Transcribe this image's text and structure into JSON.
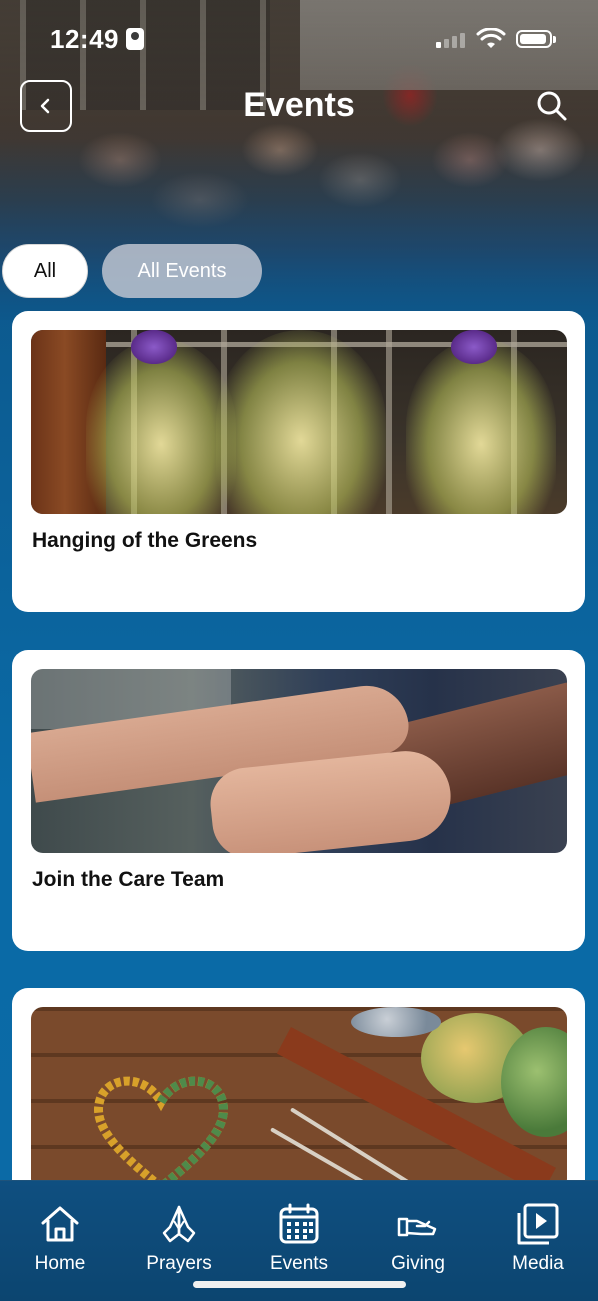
{
  "status_bar": {
    "time": "12:49"
  },
  "nav": {
    "title": "Events"
  },
  "filters": [
    {
      "label": "All",
      "selected": true
    },
    {
      "label": "All Events",
      "selected": false
    }
  ],
  "events": [
    {
      "title": "Hanging of the Greens",
      "image": "christmas-trees-photo"
    },
    {
      "title": "Join the Care Team",
      "image": "holding-hands-photo"
    },
    {
      "title": "",
      "image": "yarn-crochet-photo"
    }
  ],
  "tabbar": {
    "items": [
      {
        "label": "Home",
        "icon": "home-icon"
      },
      {
        "label": "Prayers",
        "icon": "praying-hands-icon"
      },
      {
        "label": "Events",
        "icon": "calendar-icon"
      },
      {
        "label": "Giving",
        "icon": "giving-hand-icon"
      },
      {
        "label": "Media",
        "icon": "media-play-icon"
      }
    ]
  },
  "colors": {
    "background": "#0a6ba6",
    "tabbar": "#0f4f80",
    "chip_selected_bg": "#ffffff",
    "chip_unselected_bg": "#bec4d0"
  }
}
